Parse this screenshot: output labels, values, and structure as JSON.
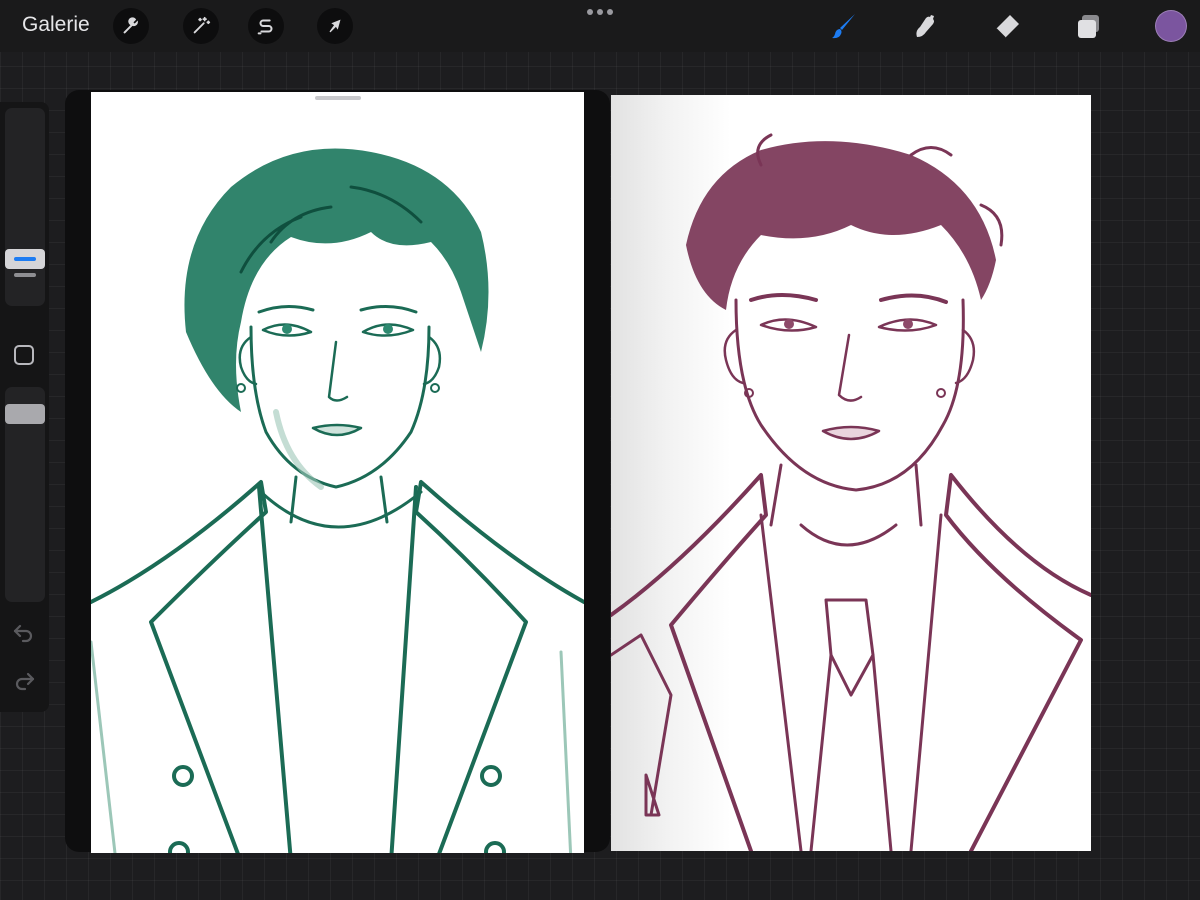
{
  "app": {
    "gallery_label": "Galerie"
  },
  "toolbar": {
    "left_tools": [
      {
        "name": "actions",
        "icon": "wrench-icon"
      },
      {
        "name": "adjustments",
        "icon": "magic-wand-icon"
      },
      {
        "name": "selection",
        "icon": "selection-s-icon"
      },
      {
        "name": "transform",
        "icon": "arrow-cursor-icon"
      }
    ],
    "more_icon": "more-dots-icon",
    "right_tools": [
      {
        "name": "brush",
        "icon": "brush-icon",
        "active": true
      },
      {
        "name": "smudge",
        "icon": "smudge-icon",
        "active": false
      },
      {
        "name": "eraser",
        "icon": "eraser-icon",
        "active": false
      },
      {
        "name": "layers",
        "icon": "layers-icon",
        "active": false
      }
    ],
    "current_color": "#7b559f",
    "accent_color": "#1d7cf2"
  },
  "sidebar": {
    "brush_size_icon": "size-slider-thumb",
    "modify_icon": "square-modify-icon",
    "opacity_icon": "opacity-slider-thumb",
    "undo_icon": "undo-arrow-icon",
    "redo_icon": "redo-arrow-icon"
  },
  "canvases": [
    {
      "name": "green-portrait",
      "ink_color": "#1b6b55",
      "description_icon": "portrait-drawing"
    },
    {
      "name": "maroon-portrait",
      "ink_color": "#7a3556",
      "description_icon": "portrait-drawing"
    }
  ]
}
